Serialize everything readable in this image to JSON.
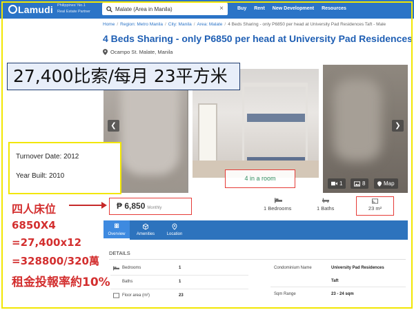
{
  "header": {
    "logo": "Lamudi",
    "tagline_line1": "Philippines' No.1",
    "tagline_line2": "Real Estate Partner",
    "search_value": "Malate (Area in Manila)",
    "nav": [
      "Buy",
      "Rent",
      "New Development",
      "Resources"
    ]
  },
  "breadcrumb": {
    "home": "Home",
    "region": "Region: Metro Manila",
    "city": "City: Manila",
    "area": "Area: Malate",
    "current": "4 Beds Sharing - only P6850 per head at University Pad Residences Taft - Male"
  },
  "listing": {
    "title": "4 Beds Sharing - only P6850 per head at University Pad Residences",
    "address": "Ocampo St. Malate, Manila",
    "price": "₱ 6,850",
    "price_unit": "Monthly",
    "bedrooms": "1 Bedrooms",
    "baths": "1 Baths",
    "area": "23 m²"
  },
  "gallery": {
    "room_label": "4 in a room",
    "video_count": "1",
    "photo_count": "8",
    "map_label": "Map"
  },
  "tabs": [
    "Overview",
    "Amenities",
    "Location"
  ],
  "details": {
    "heading": "DETAILS",
    "left": [
      {
        "label": "Bedrooms",
        "value": "1"
      },
      {
        "label": "Baths",
        "value": "1"
      },
      {
        "label": "Floor area (m²)",
        "value": "23"
      }
    ],
    "right": [
      {
        "label": "Condominium Name",
        "value": "University Pad Residences",
        "value2": "Taft"
      },
      {
        "label": "Sqm Range",
        "value": "23 - 24 sqm"
      }
    ]
  },
  "overlay": {
    "banner": "27,400比索/每月  23平方米",
    "turnover": "Turnover Date: 2012",
    "year_built": "Year Built: 2010",
    "anno_lines": [
      "四人床位",
      "6850X4",
      "=27,400x12",
      "=328800/320萬",
      "租金投報率約10%"
    ]
  },
  "colors": {
    "brand_blue": "#2b74c7",
    "annotation_red": "#d32f2f",
    "frame_yellow": "#f2e600"
  }
}
